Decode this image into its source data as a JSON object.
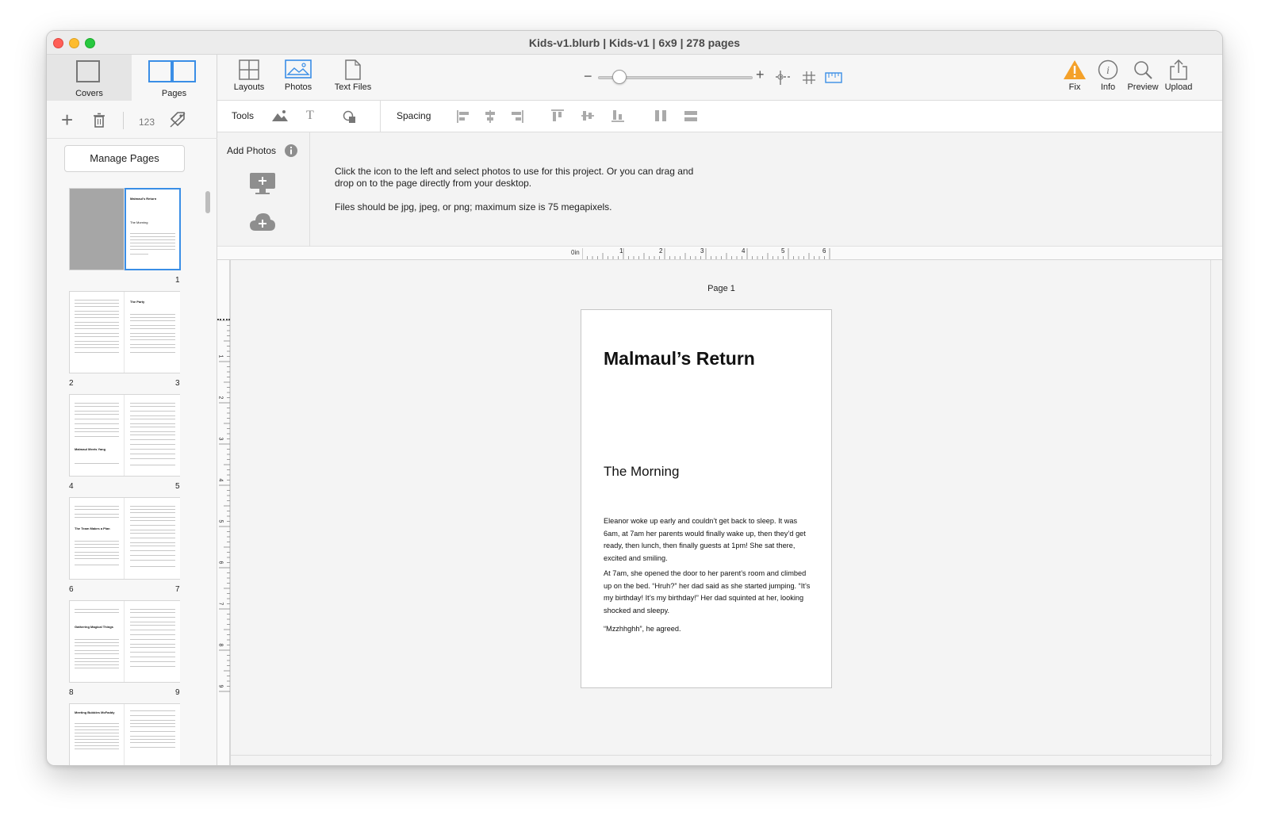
{
  "window": {
    "title": "Kids-v1.blurb | Kids-v1 | 6x9 | 278 pages"
  },
  "sidebar": {
    "segments": [
      "Covers",
      "Pages"
    ],
    "tools": {
      "add": "+",
      "delete": "trash-icon",
      "numbering": "123",
      "tag": "tag-icon"
    },
    "manage_pages": "Manage Pages",
    "spreads": [
      {
        "left": "1"
      },
      {
        "left": "2",
        "right": "3"
      },
      {
        "left": "4",
        "right": "5"
      },
      {
        "left": "6",
        "right": "7"
      },
      {
        "left": "8",
        "right": "9"
      }
    ],
    "numbers": {
      "p1": "1",
      "p2": "2",
      "p3": "3",
      "p4": "4",
      "p5": "5",
      "p6": "6",
      "p7": "7",
      "p8": "8",
      "p9": "9"
    },
    "thumb_titles": {
      "p1": "Malmaul's Return",
      "p1b": "The Morning",
      "p3": "The Party",
      "p4": "Malmaul Meets Yang",
      "p6": "The Team Makes a Plan",
      "p8": "Gathering Magical Things",
      "p10": "Meeting Bubbles McFaddy"
    }
  },
  "toolbar": {
    "layouts": "Layouts",
    "photos": "Photos",
    "text_files": "Text Files",
    "zoom_minus": "−",
    "zoom_plus": "+",
    "zoom_level": 0.1,
    "fix": "Fix",
    "info": "Info",
    "preview": "Preview",
    "upload": "Upload"
  },
  "toolbar2": {
    "tools": "Tools",
    "spacing": "Spacing"
  },
  "photos_panel": {
    "add_photos": "Add Photos",
    "instr1": "Click the icon to the left and select photos to use for this project. Or you can drag and",
    "instr2": "drop on to the page directly from your desktop.",
    "instr3": "Files should be jpg, jpeg, or png; maximum size is 75 megapixels."
  },
  "ruler": {
    "zero": "0in",
    "h": [
      "1",
      "2",
      "3",
      "4",
      "5",
      "6"
    ],
    "v": [
      "1",
      "2",
      "3",
      "4",
      "5",
      "6",
      "7",
      "8",
      "9"
    ]
  },
  "page": {
    "label": "Page 1",
    "title": "Malmaul’s Return",
    "subtitle": "The Morning",
    "para1": "Eleanor woke up early and couldn’t get back to sleep. It was 6am, at 7am her parents would finally wake up, then they’d get ready, then lunch, then finally guests at 1pm! She sat there, excited and smiling.",
    "para2": "At 7am, she opened the door to her parent’s room and climbed up on the bed. “Hruh?” her dad said as she started jumping. “It’s my birthday! It’s my birthday!” Her dad squinted at her, looking shocked and sleepy.",
    "para3": "“Mzzhhghh”, he agreed."
  },
  "colors": {
    "accent": "#3a8ee6",
    "warning": "#f4a12a",
    "close": "#ff5f57",
    "minimize": "#febc2e",
    "zoom": "#28c840"
  }
}
